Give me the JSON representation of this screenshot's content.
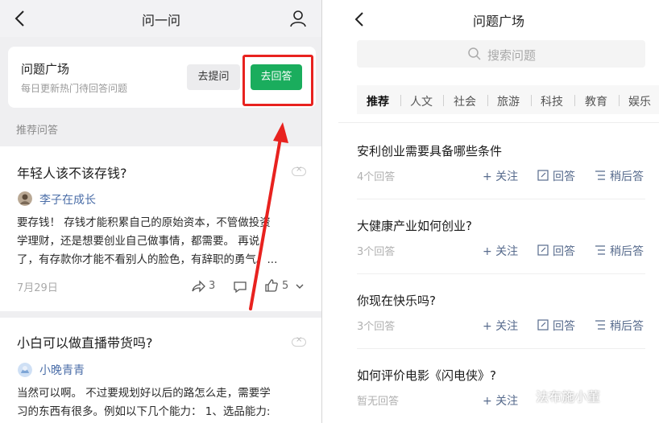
{
  "left": {
    "title": "问一问",
    "card": {
      "title": "问题广场",
      "subtitle": "每日更新热门待回答问题",
      "ask_label": "去提问",
      "answer_label": "去回答"
    },
    "section_label": "推荐问答",
    "posts": [
      {
        "title": "年轻人该不该存钱?",
        "author": "李子在成长",
        "lines": [
          "要存钱！ 存钱才能积累自己的原始资本，不管做投资",
          "学理财，还是想要创业自己做事情，都需要。 再说",
          "了，有存款你才能不看别人的脸色，有辞职的勇气。..."
        ],
        "date": "7月29日",
        "shares": "3",
        "likes": "5"
      },
      {
        "title": "小白可以做直播带货吗?",
        "author": "小晚青青",
        "lines": [
          "当然可以啊。 不过要规划好以后的路怎么走，需要学",
          "习的东西有很多。例如以下几个能力： 1、选品能力:"
        ]
      }
    ]
  },
  "right": {
    "title": "问题广场",
    "search_placeholder": "搜索问题",
    "tabs": [
      "推荐",
      "人文",
      "社会",
      "旅游",
      "科技",
      "教育",
      "娱乐"
    ],
    "actions": {
      "follow": "+ 关注",
      "answer": "回答",
      "later": "稍后答"
    },
    "items": [
      {
        "title": "安利创业需要具备哪些条件",
        "meta": "4个回答"
      },
      {
        "title": "大健康产业如何创业?",
        "meta": "3个回答"
      },
      {
        "title": "你现在快乐吗?",
        "meta": "3个回答"
      },
      {
        "title": "如何评价电影《闪电侠》?",
        "meta": "暂无回答"
      }
    ],
    "watermark": "法布施小董"
  },
  "colors": {
    "accent_green": "#1aad5d",
    "highlight_red": "#e8221f",
    "link_blue": "#4b6ea8"
  }
}
